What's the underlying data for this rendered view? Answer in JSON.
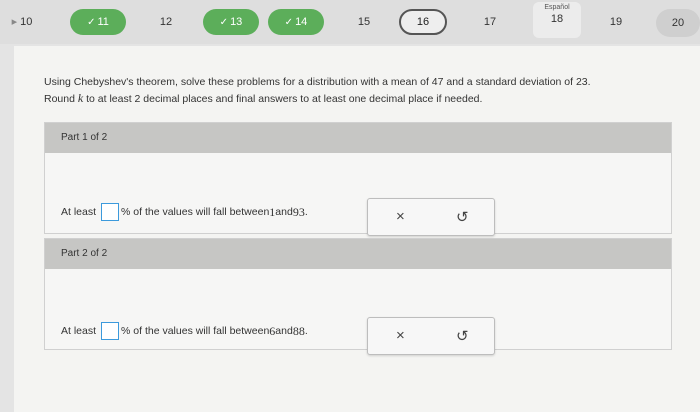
{
  "nav": {
    "items": [
      {
        "label": "10",
        "state": "plain"
      },
      {
        "label": "11",
        "state": "done"
      },
      {
        "label": "12",
        "state": "plain"
      },
      {
        "label": "13",
        "state": "done"
      },
      {
        "label": "14",
        "state": "done"
      },
      {
        "label": "15",
        "state": "plain"
      },
      {
        "label": "16",
        "state": "current"
      },
      {
        "label": "17",
        "state": "plain"
      },
      {
        "label": "18",
        "state": "plain"
      },
      {
        "label": "19",
        "state": "plain"
      },
      {
        "label": "20",
        "state": "plain"
      }
    ],
    "lang_label": "Español",
    "check_glyph": "✓"
  },
  "problem": {
    "line1": "Using Chebyshev's theorem, solve these problems for a distribution with a mean of 47 and a standard deviation of 23.",
    "line2_pre": "Round ",
    "line2_k": "k",
    "line2_post": " to at least 2 decimal places and final answers to at least one decimal place if needed."
  },
  "parts": [
    {
      "title": "Part 1 of 2",
      "prefix": "At least",
      "suffix": "% of the values will fall between ",
      "low": "1",
      "and": " and ",
      "high": "93",
      "end": "."
    },
    {
      "title": "Part 2 of 2",
      "prefix": "At least",
      "suffix": "% of the values will fall between ",
      "low": "6",
      "and": " and ",
      "high": "88",
      "end": "."
    }
  ],
  "buttons": {
    "clear_glyph": "×",
    "undo_glyph": "↺"
  },
  "colors": {
    "done": "#5cae5a",
    "input_border": "#3c9adc"
  }
}
